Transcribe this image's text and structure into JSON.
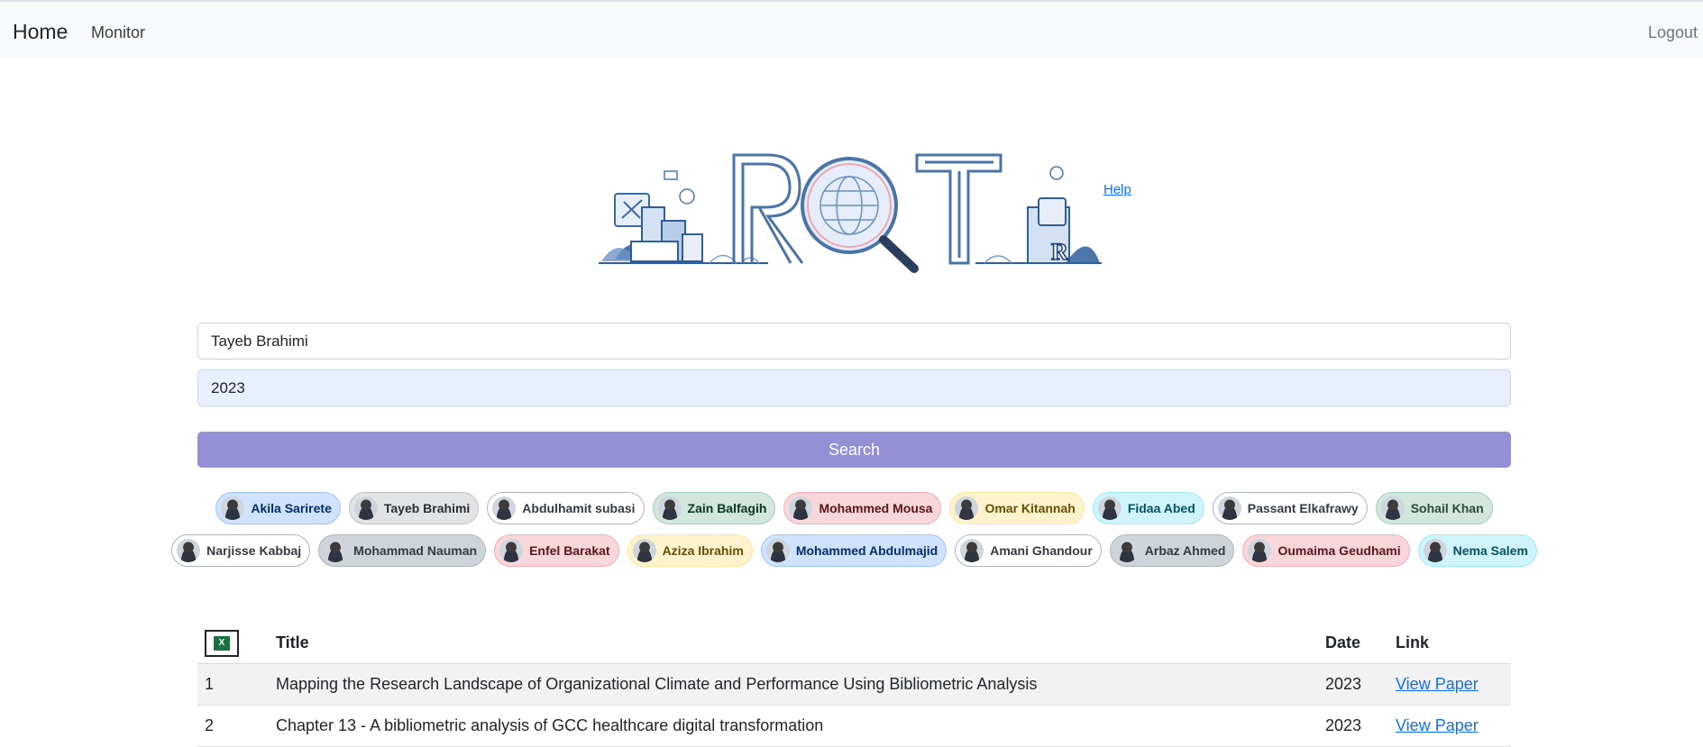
{
  "nav": {
    "brand": "Home",
    "monitor": "Monitor",
    "logout": "Logout"
  },
  "logo": {
    "text": "RQT"
  },
  "help": "Help",
  "search": {
    "author_value": "Tayeb Brahimi",
    "year_value": "2023",
    "button_label": "Search",
    "button_color": "#9490d6"
  },
  "authors_row1": [
    "Akila Sarirete",
    "Tayeb Brahimi",
    "Abdulhamit subasi",
    "Zain Balfagih",
    "Mohammed Mousa",
    "Omar Kitannah",
    "Fidaa Abed",
    "Passant Elkafrawy",
    "Sohail Khan"
  ],
  "authors_row2": [
    "Narjisse Kabbaj",
    "Mohammad Nauman",
    "Enfel Barakat",
    "Aziza Ibrahim",
    "Mohammed Abdulmajid",
    "Amani Ghandour",
    "Arbaz Ahmed",
    "Oumaima Geudhami",
    "Nema Salem"
  ],
  "table": {
    "excel_icon": "excel-icon",
    "headers": {
      "title": "Title",
      "date": "Date",
      "link": "Link"
    },
    "rows": [
      {
        "num": "1",
        "title": "Mapping the Research Landscape of Organizational Climate and Performance Using Bibliometric Analysis",
        "date": "2023",
        "link": "View Paper"
      },
      {
        "num": "2",
        "title": "Chapter 13 - A bibliometric analysis of GCC healthcare digital transformation",
        "date": "2023",
        "link": "View Paper"
      }
    ]
  }
}
